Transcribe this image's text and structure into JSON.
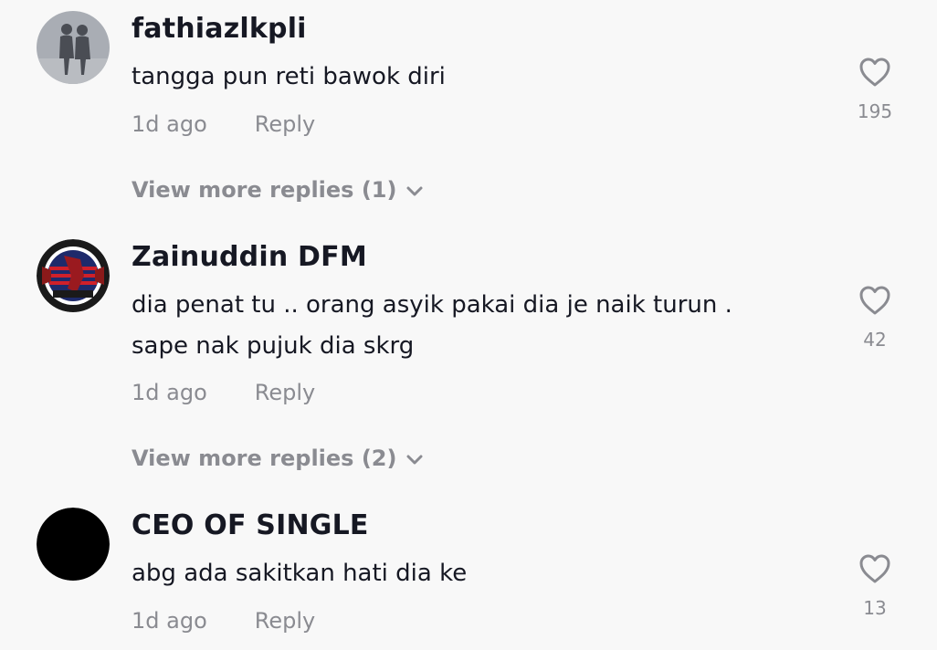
{
  "comments": [
    {
      "username": "fathiazlkpli",
      "lines": [
        "tangga pun reti bawok diri"
      ],
      "time": "1d ago",
      "reply_label": "Reply",
      "likes": "195",
      "view_more": "View more replies (1)"
    },
    {
      "username": "Zainuddin DFM",
      "lines": [
        "dia penat tu .. orang asyik pakai dia je naik turun .",
        "sape nak pujuk dia skrg"
      ],
      "time": "1d ago",
      "reply_label": "Reply",
      "likes": "42",
      "view_more": "View more replies (2)"
    },
    {
      "username": "CEO OF SINGLE",
      "lines": [
        "abg ada sakitkan hati dia ke"
      ],
      "time": "1d ago",
      "reply_label": "Reply",
      "likes": "13"
    }
  ],
  "icons": {
    "like": "heart-outline-icon",
    "expand": "chevron-down-icon"
  },
  "colors": {
    "background": "#f8f8f8",
    "primary_text": "#161823",
    "secondary_text": "#8a8b91"
  }
}
